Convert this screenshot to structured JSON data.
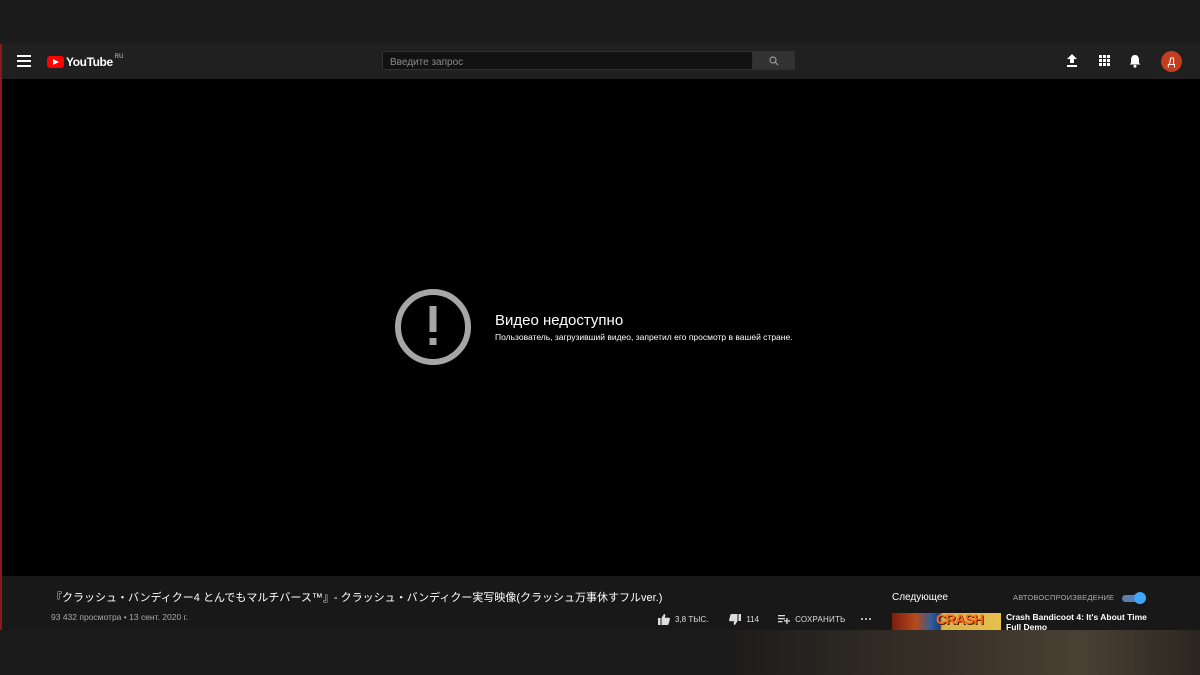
{
  "header": {
    "logo_text": "YouTube",
    "region": "RU",
    "search_placeholder": "Введите запрос",
    "avatar_letter": "Д"
  },
  "player": {
    "error_title": "Видео недоступно",
    "error_message": "Пользователь, загрузивший видео, запретил его просмотр в вашей стране."
  },
  "video": {
    "title": "『クラッシュ・バンディクー4 とんでもマルチバース™』- クラッシュ・バンディクー実写映像(クラッシュ万事休すフルver.)",
    "views": "93 432 просмотра",
    "separator": "•",
    "date": "13 сент. 2020 г.",
    "likes": "3,8 ТЫС.",
    "dislikes": "114",
    "save_label": "СОХРАНИТЬ"
  },
  "sidebar": {
    "next_label": "Следующее",
    "autoplay_label": "АВТОВОСПРОИЗВЕДЕНИЕ",
    "autoplay_on": true,
    "recommendation": {
      "thumb_text": "CRASH",
      "title": "Crash Bandicoot 4: It's About Time Full Demo"
    }
  },
  "colors": {
    "accent": "#3ea6ff",
    "brand_red": "#ff0000",
    "avatar": "#c33d21"
  }
}
